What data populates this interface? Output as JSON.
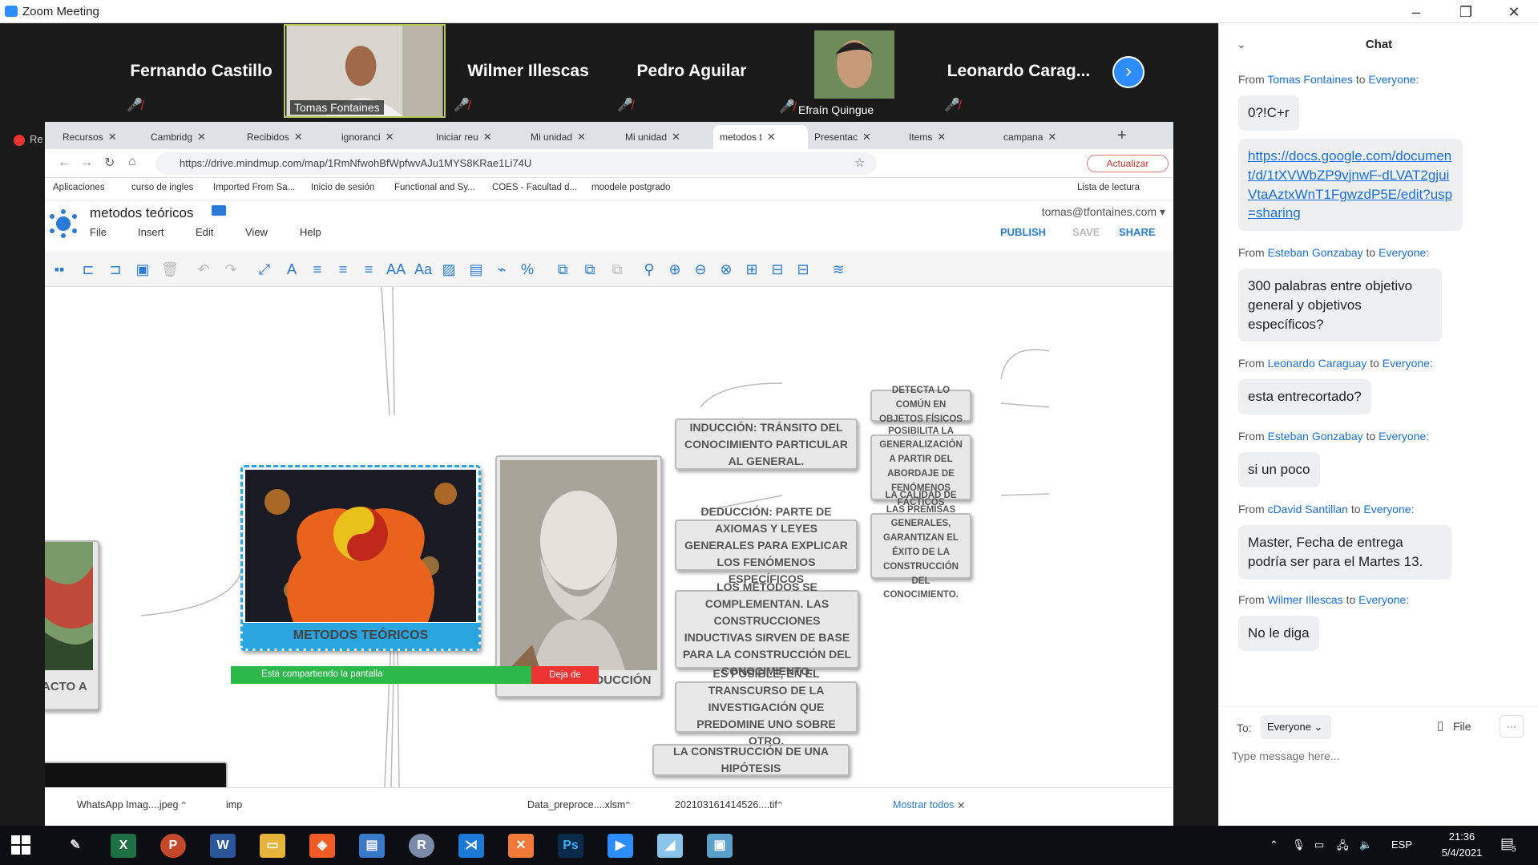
{
  "window": {
    "title": "Zoom Meeting"
  },
  "participants": [
    {
      "name": "Fernando Castillo",
      "type": "name",
      "muted": true
    },
    {
      "name": "Tomas Fontaines",
      "type": "video",
      "muted": false
    },
    {
      "name": "Wilmer Illescas",
      "type": "name",
      "muted": true
    },
    {
      "name": "Pedro Aguilar",
      "type": "name",
      "muted": true
    },
    {
      "name": "Efraín Quingue",
      "type": "video",
      "muted": true
    },
    {
      "name": "Leonardo Carag...",
      "type": "name",
      "muted": true
    }
  ],
  "browser": {
    "rec_label": "Re",
    "tabs": [
      {
        "label": "Recursos"
      },
      {
        "label": "Cambridg"
      },
      {
        "label": "Recibidos"
      },
      {
        "label": "ignoranci"
      },
      {
        "label": "Iniciar reu"
      },
      {
        "label": "Mi unidad"
      },
      {
        "label": "Mi unidad"
      },
      {
        "label": "metodos t"
      },
      {
        "label": "Presentac"
      },
      {
        "label": "Items"
      },
      {
        "label": "campana"
      }
    ],
    "new_tab": "+",
    "url": "https://drive.mindmup.com/map/1RmNfwohBfWpfwvAJu1MYS8KRae1Li74U",
    "update_label": "Actualizar",
    "bookmarks": [
      {
        "label": "Aplicaciones"
      },
      {
        "label": "curso de ingles"
      },
      {
        "label": "Imported From Sa..."
      },
      {
        "label": "Inicio de sesión"
      },
      {
        "label": "Functional and Sy..."
      },
      {
        "label": "COES - Facultad d..."
      },
      {
        "label": "moodele postgrado"
      }
    ],
    "reading_list": "Lista de lectura"
  },
  "mindmup": {
    "title": "metodos teóricos",
    "menu": [
      "File",
      "Insert",
      "Edit",
      "View",
      "Help"
    ],
    "user": "tomas@tfontaines.com",
    "publish": "PUBLISH",
    "save": "SAVE",
    "share": "SHARE",
    "nodes": {
      "center": "METODOS TEÓRICOS",
      "left_partial": "ACTO A",
      "aristotle": "INDUCCIÓN-DEDUCCIÓN",
      "induccion": "INDUCCIÓN: TRÁNSITO DEL CONOCIMIENTO PARTICULAR AL GENERAL.",
      "deduccion": "DEDUCCIÓN: PARTE DE AXIOMAS Y LEYES GENERALES PARA EXPLICAR LOS FENÓMENOS ESPECÍFICOS",
      "complementan": "LOS MÉTODOS SE COMPLEMENTAN. LAS CONSTRUCCIONES INDUCTIVAS SIRVEN DE BASE PARA LA CONSTRUCCIÓN DEL CONOCIMIENTO.",
      "posible": "ES POSIBLE, EN EL TRANSCURSO DE LA INVESTIGACIÓN QUE PREDOMINE UNO SOBRE OTRO.",
      "hipotesis": "LA CONSTRUCCIÓN DE UNA HIPÓTESIS",
      "detecta": "DETECTA LO COMÚN EN OBJETOS FÍSICOS",
      "posibilita": "POSIBILITA LA GENERALIZACIÓN A PARTIR DEL ABORDAJE DE FENÓMENOS FÁCTICOS",
      "calidad": "LA CALIDAD DE LAS PREMISAS GENERALES, GARANTIZAN EL ÉXITO DE LA CONSTRUCCIÓN DEL CONOCIMIENTO."
    }
  },
  "downloads": {
    "items": [
      "WhatsApp Imag....jpeg",
      "imp",
      "Data_preproce....xlsm",
      "202103161414526....tif"
    ],
    "show_all": "Mostrar todos",
    "sharing_text": "Está compartiendo la pantalla",
    "stop_label": "Deja de"
  },
  "chat": {
    "title": "Chat",
    "messages": [
      {
        "from": "Tomas Fontaines",
        "text": "0?!C+r",
        "link": false
      },
      {
        "from": "",
        "text": "https://docs.google.com/document/d/1tXVWbZP9vjnwF-dLVAT2gjuiVtaAztxWnT1FgwzdP5E/edit?usp=sharing",
        "link": true
      },
      {
        "from": "Esteban Gonzabay",
        "text": "300 palabras entre objetivo general y objetivos específicos?",
        "link": false
      },
      {
        "from": "Leonardo Caraguay",
        "text": "esta entrecortado?",
        "link": false
      },
      {
        "from": "Esteban Gonzabay",
        "text": "si un poco",
        "link": false
      },
      {
        "from": "cDavid Santillan",
        "text": "Master, Fecha de entrega podría ser para el Martes 13.",
        "link": false
      },
      {
        "from": "Wilmer Illescas",
        "text": "No le diga",
        "link": false
      }
    ],
    "from_word": "From",
    "to_word": "to",
    "to_everyone": "Everyone:",
    "to_label": "To:",
    "to_value": "Everyone",
    "file_label": "File",
    "more_label": "···",
    "placeholder": "Type message here..."
  },
  "taskbar": {
    "lang": "ESP",
    "time": "21:36",
    "date": "5/4/2021",
    "notif_count": "5"
  }
}
